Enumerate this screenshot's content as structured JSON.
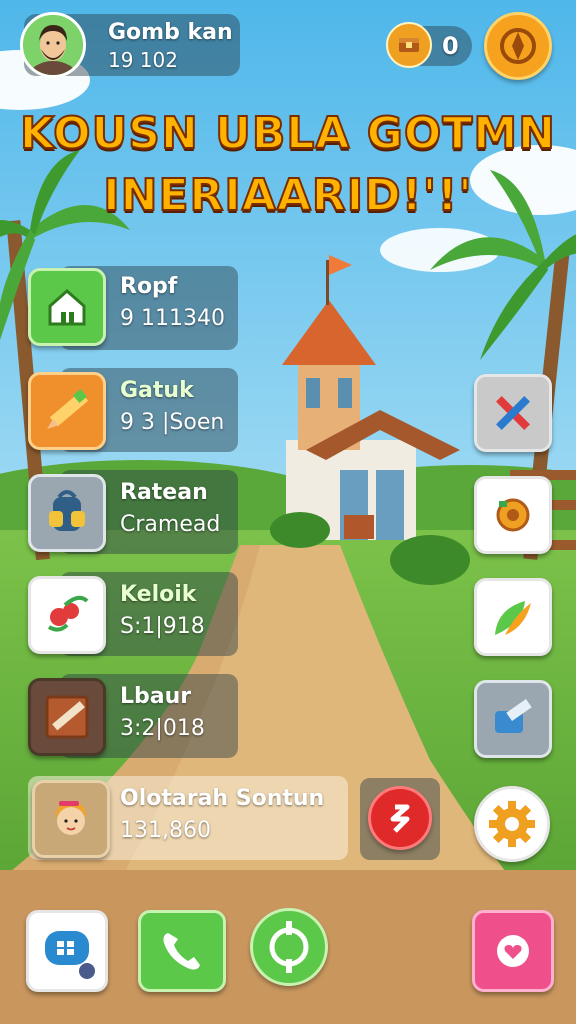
{
  "header": {
    "player_name": "Gomb kan",
    "player_score": "19 102",
    "currency_value": "0",
    "avatar_icon": "player-avatar",
    "currency_icon": "coin-chest-icon",
    "top_right_icon": "compass-icon"
  },
  "title": {
    "line1": "KOUSN UBLA GOTMN",
    "line2": "INERIAARID!'!'"
  },
  "left_menu": [
    {
      "name": "Ropf",
      "value": "9 111340",
      "icon": "home-icon",
      "color": "#5cc84a"
    },
    {
      "name": "Gatuk",
      "value": "9 3 |Soen",
      "icon": "pencil-ruler-icon",
      "color": "#f0902c"
    },
    {
      "name": "Ratean",
      "value": "Cramead",
      "icon": "backpack-icon",
      "color": "#9aa7b0"
    },
    {
      "name": "Keloik",
      "value": "S:1|918",
      "icon": "berries-icon",
      "color": "#ffffff"
    },
    {
      "name": "Lbaur",
      "value": "3:2|018",
      "icon": "crate-icon",
      "color": "#6a4a3a"
    },
    {
      "name": "Olotarah Sontun",
      "value": "131,860",
      "icon": "character-portrait-icon",
      "color": "#c9a878"
    }
  ],
  "right_menu": [
    {
      "icon": "crossed-pencils-icon",
      "color": "#c9c9c9"
    },
    {
      "icon": "gear-shield-icon",
      "color": "#ffffff"
    },
    {
      "icon": "leaf-brush-icon",
      "color": "#ffffff"
    },
    {
      "icon": "tape-roll-icon",
      "color": "#9aa7b0"
    },
    {
      "icon": "settings-gear-icon",
      "color": "#ffffff"
    }
  ],
  "bottom_bar": [
    {
      "icon": "chat-icon",
      "color": "#ffffff"
    },
    {
      "icon": "phone-icon",
      "color": "#5cc84a"
    },
    {
      "icon": "target-icon",
      "color": "#5cc84a"
    },
    {
      "icon": "heart-icon",
      "color": "#ef4f8b"
    }
  ],
  "red_button_icon": "dollar-icon"
}
